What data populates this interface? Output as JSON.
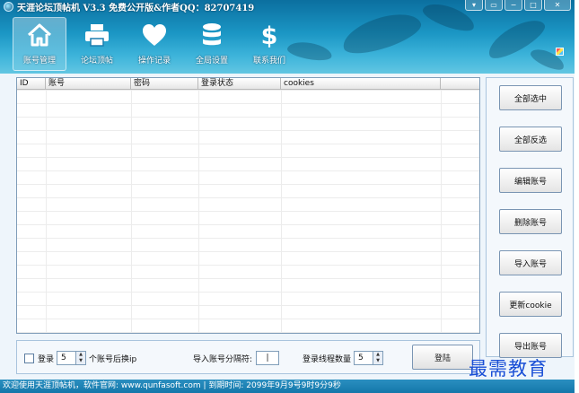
{
  "window": {
    "title": "天涯论坛顶帖机 V3.3 免费公开版&作者QQ：82707419",
    "controls": [
      "▾",
      "▭",
      "−",
      "□",
      "✕"
    ]
  },
  "nav": [
    {
      "label": "账号管理",
      "icon": "home-icon",
      "active": true
    },
    {
      "label": "论坛顶帖",
      "icon": "printer-icon",
      "active": false
    },
    {
      "label": "操作记录",
      "icon": "heart-icon",
      "active": false
    },
    {
      "label": "全局设置",
      "icon": "database-icon",
      "active": false
    },
    {
      "label": "联系我们",
      "icon": "dollar-icon",
      "active": false
    }
  ],
  "table": {
    "columns": [
      "ID",
      "账号",
      "密码",
      "登录状态",
      "cookies"
    ],
    "rows": []
  },
  "side_buttons": [
    "全部选中",
    "全部反选",
    "编辑账号",
    "删除账号",
    "导入账号",
    "更新cookie",
    "导出账号"
  ],
  "options": {
    "login_label": "登录",
    "switch_count": "5",
    "switch_suffix": "个账号后换ip",
    "separator_label": "导入账号分隔符:",
    "separator_value": "|",
    "threads_label": "登录线程数量",
    "threads_value": "5",
    "login_button": "登陆"
  },
  "status_bar": "欢迎使用天涯顶帖机，软件官网: www.qunfasoft.com  |  到期时间: 2099年9月9号9时9分9秒",
  "watermark": "最需教育"
}
